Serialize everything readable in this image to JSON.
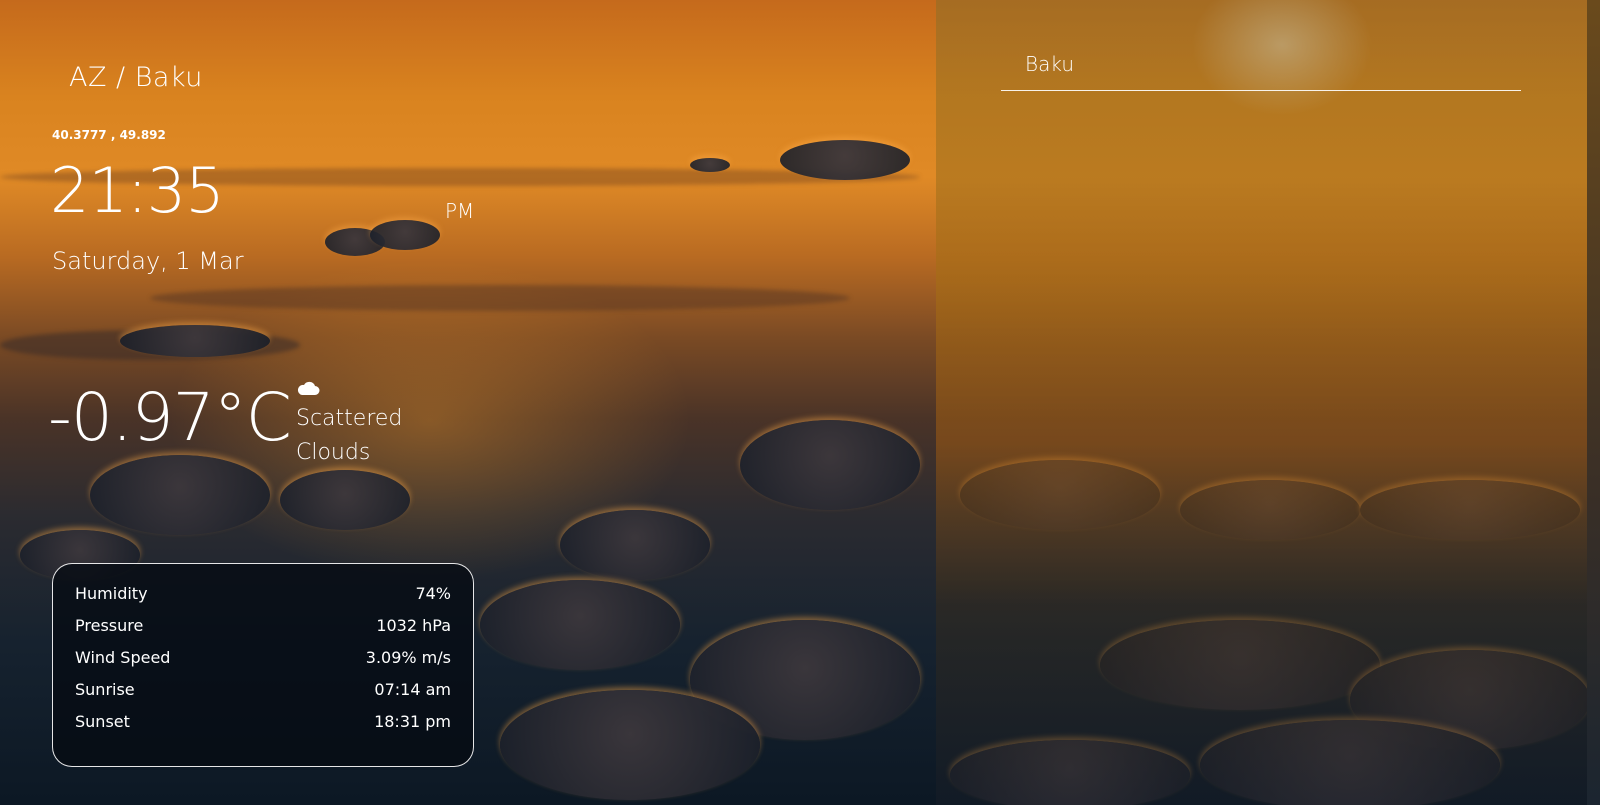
{
  "search": {
    "value": "Baku",
    "placeholder": "Baku"
  },
  "location": "AZ / Baku",
  "coordinates": "40.3777 , 49.892",
  "time": "21:35",
  "ampm": "PM",
  "date": "Saturday, 1 Mar",
  "weather": {
    "temperature": "-0.97°C",
    "condition": "Scattered Clouds",
    "icon": "cloud-icon"
  },
  "details": [
    {
      "label": "Humidity",
      "value": "74%"
    },
    {
      "label": "Pressure",
      "value": "1032 hPa"
    },
    {
      "label": "Wind Speed",
      "value": "3.09% m/s"
    },
    {
      "label": "Sunrise",
      "value": "07:14 am"
    },
    {
      "label": "Sunset",
      "value": "18:31 pm"
    }
  ]
}
